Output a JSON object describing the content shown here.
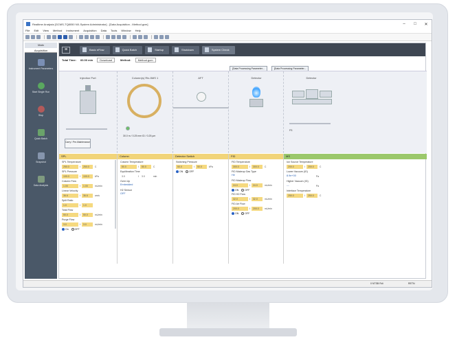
{
  "window": {
    "title": "Realtime Analysis [GCMS-TQ8050 NX-System Administrator] - [Data Acquisition - Method.gcm]",
    "min": "–",
    "max": "□",
    "close": "✕"
  },
  "menu": [
    "File",
    "Edit",
    "View",
    "Method",
    "Instrument",
    "Acquisition",
    "Data",
    "Tools",
    "Window",
    "Help"
  ],
  "nav": {
    "header": "Main",
    "sub": "Acquisition",
    "items": [
      {
        "label": "Instrument Parameters",
        "icon": "instrument-icon",
        "color": "#7a8fb5"
      },
      {
        "label": "Start Single Run",
        "icon": "start-icon",
        "color": "#5aa85f"
      },
      {
        "label": "Stop",
        "icon": "stop-icon",
        "color": "#b35a5a"
      },
      {
        "label": "Quick Batch",
        "icon": "batch-icon",
        "color": "#6aa36a"
      },
      {
        "label": "Snapshot",
        "icon": "snapshot-icon",
        "color": "#8695ad"
      },
      {
        "label": "Data Analysis",
        "icon": "analysis-icon",
        "color": "#7f9a7f"
      }
    ]
  },
  "flowbar": {
    "menu_icon": "≡",
    "buttons": [
      "Basic eFlow",
      "Quick Batch",
      "Startup",
      "Shutdown",
      "System Check"
    ]
  },
  "info": {
    "total_time_label": "Total Time:",
    "total_time_value": "60.00 min",
    "download_label": "Download",
    "method_label": "Method:",
    "method_value": "Method.gcm"
  },
  "dp_buttons": [
    "[Data Processing Parameter...",
    "[Data Processing Parameter..."
  ],
  "flow": {
    "labels": [
      "Injection Port",
      "Column(s) Rtx-5MS 1",
      "AFT",
      "Detector",
      "Detector"
    ],
    "gc_button": "Carry / Pre-Maintenance",
    "column_text": "30.0 m / 0.25 mm ID / 0.25 µm",
    "ms_text": "FS"
  },
  "params": {
    "spl": {
      "header": "SPL",
      "fields": [
        {
          "label": "SPL Temperature",
          "v1": "250.0",
          "v2": "250.0",
          "unit": "C"
        },
        {
          "label": "SPL Pressure",
          "v1": "100.0",
          "v2": "100.0",
          "unit": "kPa"
        },
        {
          "label": "Column Flow",
          "v1": "1.00",
          "v2": "1.00",
          "unit": "mL/min"
        },
        {
          "label": "Linear Velocity",
          "v1": "36.6",
          "v2": "36.6",
          "unit": "cm/s"
        },
        {
          "label": "Split Ratio",
          "v1": "1.0",
          "v2": "1.0",
          "unit": ""
        },
        {
          "label": "Total Flow",
          "v1": "50.0",
          "v2": "50.0",
          "unit": "mL/min"
        },
        {
          "label": "Purge Flow",
          "v1": "3.0",
          "v2": "3.0",
          "unit": "mL/min"
        }
      ],
      "radio_on": "On",
      "radio_off": "OFF"
    },
    "column": {
      "header": "Column",
      "temp_label": "Column Temperature",
      "temp_v1": "50.0",
      "temp_v2": "50.0",
      "temp_unit": "C",
      "eq_label": "Equilibration Time",
      "eq_v1": "3.0",
      "eq_v2": "3.0",
      "eq_unit": "min",
      "oven_label": "Oven Up",
      "oven_value": "Embedded",
      "h2_label": "H2 Sensor",
      "h2_value": "OFF"
    },
    "switch": {
      "header": "Detector Switch",
      "label": "Switching Pressure",
      "v1": "50.0",
      "v2": "50.0",
      "unit": "kPa",
      "radio_on": "ON",
      "radio_off": "OFF"
    },
    "fid": {
      "header": "FID",
      "fields": [
        {
          "label": "FID Temperature",
          "v1": "300.0",
          "v2": "300.0",
          "unit": "C"
        },
        {
          "label": "FID Makeup Gas Type",
          "text": "He"
        },
        {
          "label": "FID Makeup Flow",
          "v1": "24.0",
          "v2": "24.0",
          "unit": "mL/min"
        },
        {
          "label": "FID H2 Flow",
          "v1": "32.0",
          "v2": "32.0",
          "unit": "mL/min"
        },
        {
          "label": "FID Air Flow",
          "v1": "200.0",
          "v2": "200.0",
          "unit": "mL/min"
        }
      ],
      "radio_on": "ON",
      "radio_off": "OFF"
    },
    "ms": {
      "header": "MS",
      "src_label": "Ion Source Temperature",
      "src_v1": "200.0",
      "src_v2": "200.0",
      "src_unit": "C",
      "lv_label": "Lower Vacuum (IG)",
      "lv_value": "8.9e+00",
      "lv_unit": "Pa",
      "hv_label": "Higher Vacuum (IG)",
      "hv_value": "---",
      "hv_unit": "Pa",
      "if_label": "Interface Temperature",
      "if_v1": "250.0",
      "if_v2": "250.0",
      "if_unit": "C"
    }
  },
  "bottom_tab": "Data Acquis...",
  "status": {
    "left": "",
    "mid": "0 NTSB Rdi",
    "right": "RETN"
  }
}
